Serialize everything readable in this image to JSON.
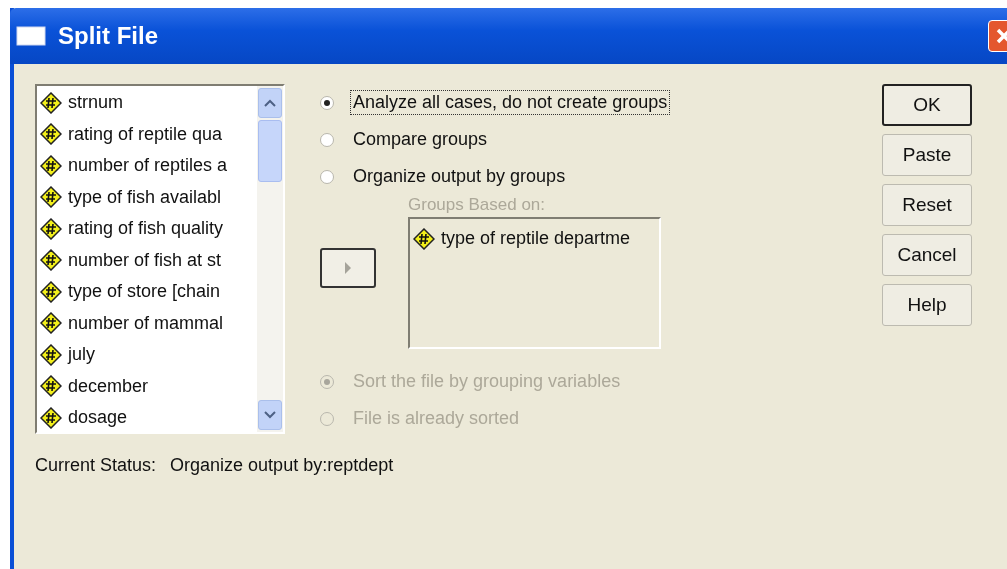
{
  "window": {
    "title": "Split File"
  },
  "variables": [
    {
      "label": "strnum"
    },
    {
      "label": "rating of reptile qua"
    },
    {
      "label": "number of reptiles a"
    },
    {
      "label": "type of fish availabl"
    },
    {
      "label": "rating of fish quality"
    },
    {
      "label": "number of fish at st"
    },
    {
      "label": "type of store [chain"
    },
    {
      "label": "number of mammal"
    },
    {
      "label": "july"
    },
    {
      "label": "december"
    },
    {
      "label": "dosage"
    }
  ],
  "split_options": [
    {
      "label": "Analyze all cases, do not create groups",
      "selected": true,
      "focused": true
    },
    {
      "label": "Compare groups",
      "selected": false,
      "focused": false
    },
    {
      "label": "Organize output by groups",
      "selected": false,
      "focused": false
    }
  ],
  "groups": {
    "label": "Groups Based on:",
    "disabled": true,
    "items": [
      {
        "label": "type of reptile departme"
      }
    ]
  },
  "sort_options": [
    {
      "label": "Sort the file by grouping variables",
      "selected": true,
      "disabled": true
    },
    {
      "label": "File is already sorted",
      "selected": false,
      "disabled": true
    }
  ],
  "status": {
    "label": "Current Status:",
    "value": "Organize output by:reptdept"
  },
  "buttons": [
    {
      "label": "OK",
      "default": true
    },
    {
      "label": "Paste",
      "default": false
    },
    {
      "label": "Reset",
      "default": false
    },
    {
      "label": "Cancel",
      "default": false
    },
    {
      "label": "Help",
      "default": false
    }
  ]
}
